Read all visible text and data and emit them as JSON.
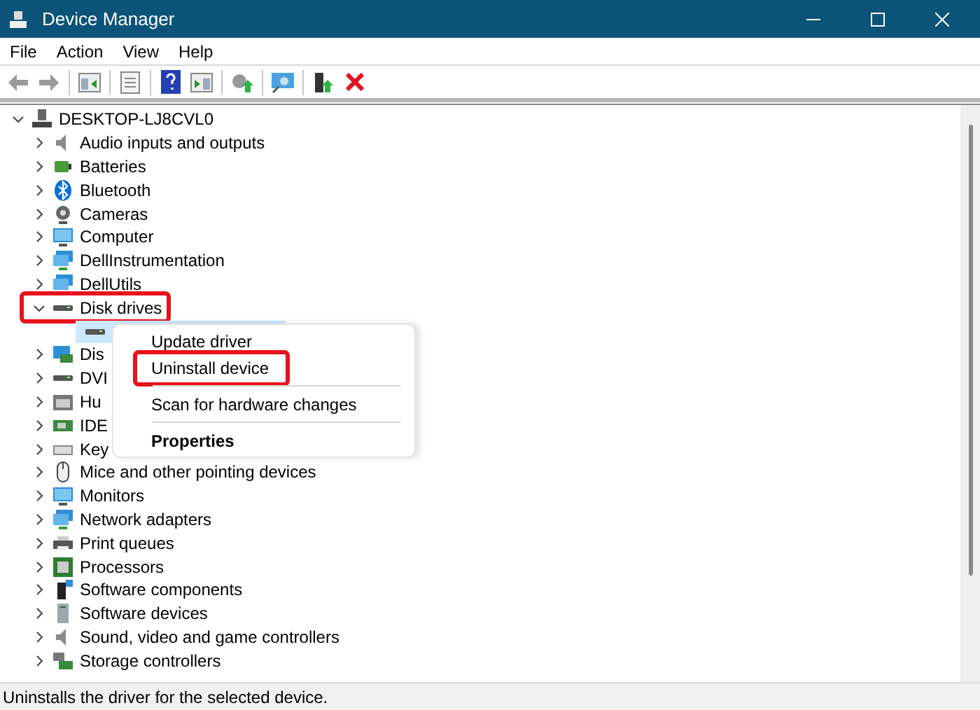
{
  "window": {
    "title": "Device Manager"
  },
  "menu_bar": [
    "File",
    "Action",
    "View",
    "Help"
  ],
  "tree": {
    "label": "DESKTOP-LJ8CVL0",
    "expanded": true,
    "children": [
      {
        "label": "Audio inputs and outputs",
        "expanded": false,
        "highlighted": false
      },
      {
        "label": "Batteries",
        "expanded": false,
        "highlighted": false
      },
      {
        "label": "Bluetooth",
        "expanded": false,
        "highlighted": false
      },
      {
        "label": "Cameras",
        "expanded": false,
        "highlighted": false
      },
      {
        "label": "Computer",
        "expanded": false,
        "highlighted": false
      },
      {
        "label": "DellInstrumentation",
        "expanded": false,
        "highlighted": false
      },
      {
        "label": "DellUtils",
        "expanded": false,
        "highlighted": false
      },
      {
        "label": "Disk drives",
        "expanded": true,
        "highlighted": true,
        "children": [
          {
            "selected": true
          }
        ]
      },
      {
        "label": "Dis",
        "expanded": false,
        "highlighted": false
      },
      {
        "label": "DVI",
        "expanded": false,
        "highlighted": false
      },
      {
        "label": "Hu",
        "expanded": false,
        "highlighted": false
      },
      {
        "label": "IDE",
        "expanded": false,
        "highlighted": false
      },
      {
        "label": "Key",
        "expanded": false,
        "highlighted": false
      },
      {
        "label": "Mice and other pointing devices",
        "expanded": false,
        "highlighted": false
      },
      {
        "label": "Monitors",
        "expanded": false,
        "highlighted": false
      },
      {
        "label": "Network adapters",
        "expanded": false,
        "highlighted": false
      },
      {
        "label": "Print queues",
        "expanded": false,
        "highlighted": false
      },
      {
        "label": "Processors",
        "expanded": false,
        "highlighted": false
      },
      {
        "label": "Software components",
        "expanded": false,
        "highlighted": false
      },
      {
        "label": "Software devices",
        "expanded": false,
        "highlighted": false
      },
      {
        "label": "Sound, video and game controllers",
        "expanded": false,
        "highlighted": false
      },
      {
        "label": "Storage controllers",
        "expanded": false,
        "highlighted": false
      }
    ]
  },
  "context_menu": [
    {
      "kind": "item",
      "label": "Update driver",
      "highlighted": false,
      "default": false
    },
    {
      "kind": "item",
      "label": "Uninstall device",
      "highlighted": true,
      "default": false
    },
    {
      "kind": "separator"
    },
    {
      "kind": "item",
      "label": "Scan for hardware changes",
      "highlighted": false,
      "default": false
    },
    {
      "kind": "separator"
    },
    {
      "kind": "item",
      "label": "Properties",
      "highlighted": false,
      "default": true
    }
  ],
  "status_bar": "Uninstalls the driver for the selected device."
}
